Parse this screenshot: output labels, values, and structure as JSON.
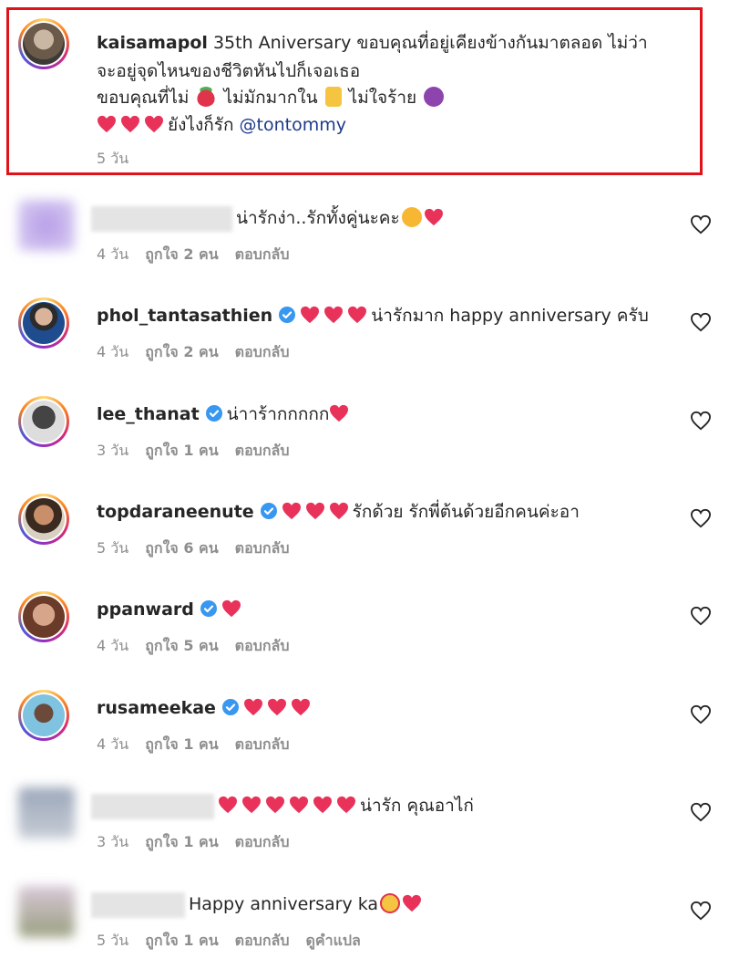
{
  "post": {
    "username": "kaisamapol",
    "caption_line1": "35th Aniversary ขอบคุณที่อยู่เคียงข้างกันมาตลอด  ไม่ว่า",
    "caption_line2": "จะอยู่จุดไหนของชีวิตหันไปก็เจอเธอ",
    "caption_line3a": "ขอบคุณที่ไม่",
    "caption_line3b": "ไม่มักมากใน",
    "caption_line3c": "ไม่ใจร้าย",
    "caption_line4": "ยังไงก็รัก",
    "mention": "@tontommy",
    "time": "5 วัน",
    "emoji_icons": [
      "strawberry-icon",
      "thumbs-up-icon",
      "devil-icon"
    ]
  },
  "comments": [
    {
      "username": "",
      "blurred": true,
      "text": "น่ารักง่า..รักทั้งคู่นะคะ",
      "time": "4 วัน",
      "likes": "ถูกใจ 2 คน",
      "reply": "ตอบกลับ",
      "hearts_before": 0,
      "hearts_after": 1,
      "extra_emoji": "kiss-face-icon"
    },
    {
      "username": "phol_tantasathien",
      "verified": true,
      "text": "น่ารักมาก happy anniversary ครับ",
      "time": "4 วัน",
      "likes": "ถูกใจ 2 คน",
      "reply": "ตอบกลับ",
      "hearts_before": 3
    },
    {
      "username": "lee_thanat",
      "verified": true,
      "text": "น่าาร้ากกกกก",
      "time": "3 วัน",
      "likes": "ถูกใจ 1 คน",
      "reply": "ตอบกลับ",
      "hearts_after": 1
    },
    {
      "username": "topdaraneenute",
      "verified": true,
      "text": "รักด้วย รักพี่ต้นด้วยอีกคนค่ะอา",
      "time": "5 วัน",
      "likes": "ถูกใจ 6 คน",
      "reply": "ตอบกลับ",
      "hearts_before": 3
    },
    {
      "username": "ppanward",
      "verified": true,
      "text": "",
      "time": "4 วัน",
      "likes": "ถูกใจ 5 คน",
      "reply": "ตอบกลับ",
      "hearts_before": 1
    },
    {
      "username": "rusameekae",
      "verified": true,
      "text": "",
      "time": "4 วัน",
      "likes": "ถูกใจ 1 คน",
      "reply": "ตอบกลับ",
      "hearts_before": 3
    },
    {
      "username": "",
      "blurred": true,
      "text": "น่ารัก คุณอาไก่",
      "time": "3 วัน",
      "likes": "ถูกใจ 1 คน",
      "reply": "ตอบกลับ",
      "hearts_before": 6
    },
    {
      "username": "",
      "blurred": true,
      "text": "Happy anniversary ka",
      "time": "5 วัน",
      "likes": "ถูกใจ 1 คน",
      "reply": "ตอบกลับ",
      "translate": "ดูคำแปล",
      "hearts_after": 1,
      "extra_emoji": "heart-eyes-icon"
    }
  ],
  "colors": {
    "heart": "#e8325a",
    "verified": "#3897f0",
    "highlight_border": "#e0121a",
    "meta": "#8e8e8e",
    "mention": "#1e3a8a"
  }
}
